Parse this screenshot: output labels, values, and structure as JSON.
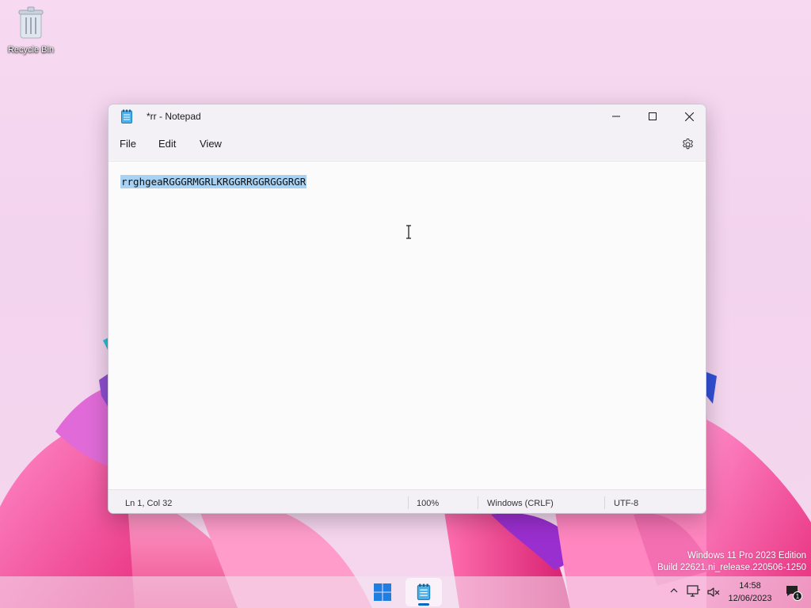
{
  "desktop": {
    "recycle_bin_label": "Recycle Bin"
  },
  "window": {
    "title": "*rr - Notepad",
    "menu": [
      "File",
      "Edit",
      "View"
    ],
    "content_text": "rrghgeaRGGGRMGRLKRGGRRGGRGGGRGR",
    "status": {
      "position": "Ln 1, Col 32",
      "zoom": "100%",
      "line_ending": "Windows (CRLF)",
      "encoding": "UTF-8"
    },
    "icons": {
      "app": "notepad-icon",
      "minimize": "minimize-icon",
      "maximize": "maximize-icon",
      "close": "close-icon",
      "settings": "gear-icon"
    }
  },
  "watermark": {
    "line1": "Windows 11 Pro 2023 Edition",
    "line2": "Build 22621.ni_release.220506-1250"
  },
  "taskbar": {
    "clock_time": "14:58",
    "clock_date": "12/06/2023",
    "notification_count": "1"
  },
  "colors": {
    "accent": "#0067c0",
    "selection": "#a8d1f2"
  }
}
